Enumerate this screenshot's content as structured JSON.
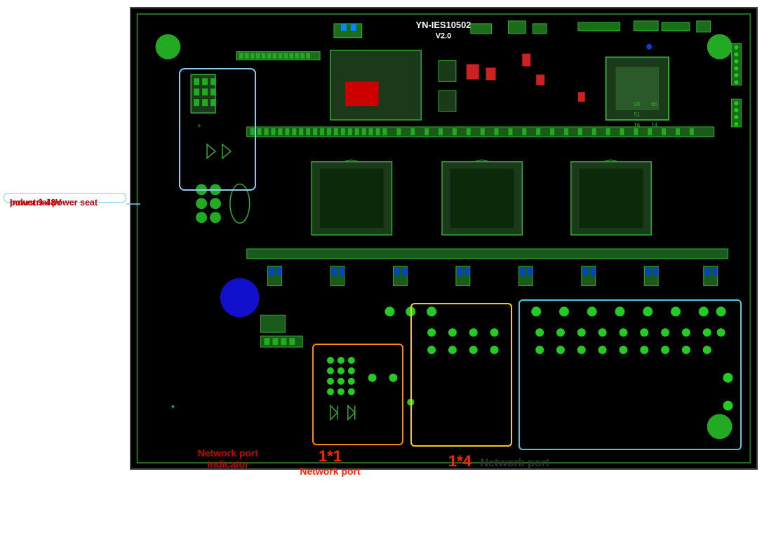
{
  "pcb": {
    "title_line1": "YN-IES10502",
    "title_line2": "V2.0"
  },
  "labels": {
    "power": {
      "line1": "Industrial power seat",
      "line2": "power 9-48V"
    },
    "network_port_indicator": {
      "line1": "Network port",
      "line2": "indicator"
    },
    "net_1x1": {
      "size": "1*1",
      "desc": "Network port"
    },
    "net_1x4": {
      "size": "1*4",
      "desc": "Network port"
    }
  },
  "colors": {
    "background": "#000000",
    "pcb_green": "#22aa22",
    "pcb_border": "#1a6e1a",
    "red_comp": "#cc2222",
    "blue_comp": "#1111cc",
    "orange_box": "#ff8800",
    "yellow_box": "#ffcc00",
    "cyan_box": "#44ccdd",
    "light_blue_box": "#88ccee",
    "label_red": "#cc0000",
    "label_orange_red": "#cc2200"
  }
}
